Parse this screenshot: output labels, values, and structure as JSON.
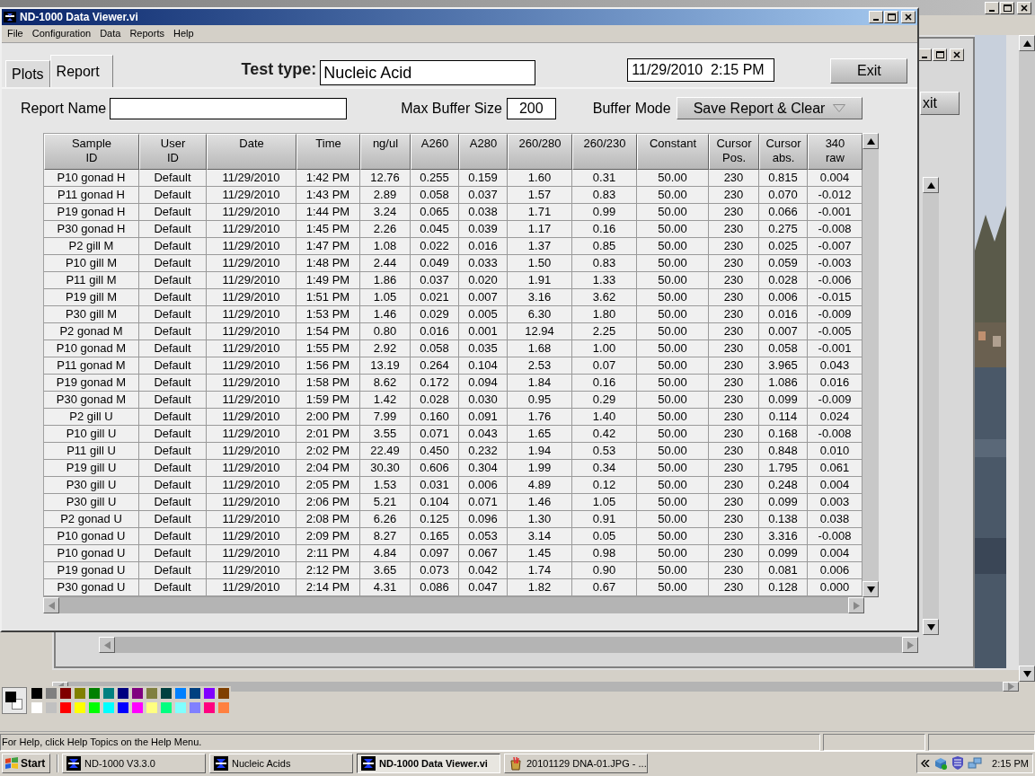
{
  "window": {
    "title": "ND-1000 Data Viewer.vi",
    "menu": [
      "File",
      "Configuration",
      "Data",
      "Reports",
      "Help"
    ]
  },
  "tabs": [
    {
      "label": "Plots",
      "selected": false
    },
    {
      "label": "Report",
      "selected": true
    }
  ],
  "test_type": {
    "label": "Test type:",
    "value": "Nucleic Acid"
  },
  "timestamp": "11/29/2010  2:15 PM",
  "exit_button": "Exit",
  "report_name": {
    "label": "Report Name"
  },
  "max_buffer": {
    "label": "Max Buffer Size",
    "value": "200"
  },
  "buffer_mode": {
    "label": "Buffer Mode",
    "value": "Save Report & Clear"
  },
  "table": {
    "columns": [
      "Sample ID",
      "User ID",
      "Date",
      "Time",
      "ng/ul",
      "A260",
      "A280",
      "260/280",
      "260/230",
      "Constant",
      "Cursor Pos.",
      "Cursor abs.",
      "340 raw"
    ],
    "rows": [
      [
        "P10 gonad H",
        "Default",
        "11/29/2010",
        "1:42 PM",
        "12.76",
        "0.255",
        "0.159",
        "1.60",
        "0.31",
        "50.00",
        "230",
        "0.815",
        "0.004"
      ],
      [
        "P11 gonad H",
        "Default",
        "11/29/2010",
        "1:43 PM",
        "2.89",
        "0.058",
        "0.037",
        "1.57",
        "0.83",
        "50.00",
        "230",
        "0.070",
        "-0.012"
      ],
      [
        "P19 gonad H",
        "Default",
        "11/29/2010",
        "1:44 PM",
        "3.24",
        "0.065",
        "0.038",
        "1.71",
        "0.99",
        "50.00",
        "230",
        "0.066",
        "-0.001"
      ],
      [
        "P30 gonad H",
        "Default",
        "11/29/2010",
        "1:45 PM",
        "2.26",
        "0.045",
        "0.039",
        "1.17",
        "0.16",
        "50.00",
        "230",
        "0.275",
        "-0.008"
      ],
      [
        "P2 gill M",
        "Default",
        "11/29/2010",
        "1:47 PM",
        "1.08",
        "0.022",
        "0.016",
        "1.37",
        "0.85",
        "50.00",
        "230",
        "0.025",
        "-0.007"
      ],
      [
        "P10 gill M",
        "Default",
        "11/29/2010",
        "1:48 PM",
        "2.44",
        "0.049",
        "0.033",
        "1.50",
        "0.83",
        "50.00",
        "230",
        "0.059",
        "-0.003"
      ],
      [
        "P11 gill M",
        "Default",
        "11/29/2010",
        "1:49 PM",
        "1.86",
        "0.037",
        "0.020",
        "1.91",
        "1.33",
        "50.00",
        "230",
        "0.028",
        "-0.006"
      ],
      [
        "P19 gill M",
        "Default",
        "11/29/2010",
        "1:51 PM",
        "1.05",
        "0.021",
        "0.007",
        "3.16",
        "3.62",
        "50.00",
        "230",
        "0.006",
        "-0.015"
      ],
      [
        "P30 gill M",
        "Default",
        "11/29/2010",
        "1:53 PM",
        "1.46",
        "0.029",
        "0.005",
        "6.30",
        "1.80",
        "50.00",
        "230",
        "0.016",
        "-0.009"
      ],
      [
        "P2 gonad M",
        "Default",
        "11/29/2010",
        "1:54 PM",
        "0.80",
        "0.016",
        "0.001",
        "12.94",
        "2.25",
        "50.00",
        "230",
        "0.007",
        "-0.005"
      ],
      [
        "P10 gonad M",
        "Default",
        "11/29/2010",
        "1:55 PM",
        "2.92",
        "0.058",
        "0.035",
        "1.68",
        "1.00",
        "50.00",
        "230",
        "0.058",
        "-0.001"
      ],
      [
        "P11 gonad M",
        "Default",
        "11/29/2010",
        "1:56 PM",
        "13.19",
        "0.264",
        "0.104",
        "2.53",
        "0.07",
        "50.00",
        "230",
        "3.965",
        "0.043"
      ],
      [
        "P19 gonad M",
        "Default",
        "11/29/2010",
        "1:58 PM",
        "8.62",
        "0.172",
        "0.094",
        "1.84",
        "0.16",
        "50.00",
        "230",
        "1.086",
        "0.016"
      ],
      [
        "P30 gonad M",
        "Default",
        "11/29/2010",
        "1:59 PM",
        "1.42",
        "0.028",
        "0.030",
        "0.95",
        "0.29",
        "50.00",
        "230",
        "0.099",
        "-0.009"
      ],
      [
        "P2 gill U",
        "Default",
        "11/29/2010",
        "2:00 PM",
        "7.99",
        "0.160",
        "0.091",
        "1.76",
        "1.40",
        "50.00",
        "230",
        "0.114",
        "0.024"
      ],
      [
        "P10 gill U",
        "Default",
        "11/29/2010",
        "2:01 PM",
        "3.55",
        "0.071",
        "0.043",
        "1.65",
        "0.42",
        "50.00",
        "230",
        "0.168",
        "-0.008"
      ],
      [
        "P11 gill U",
        "Default",
        "11/29/2010",
        "2:02 PM",
        "22.49",
        "0.450",
        "0.232",
        "1.94",
        "0.53",
        "50.00",
        "230",
        "0.848",
        "0.010"
      ],
      [
        "P19 gill U",
        "Default",
        "11/29/2010",
        "2:04 PM",
        "30.30",
        "0.606",
        "0.304",
        "1.99",
        "0.34",
        "50.00",
        "230",
        "1.795",
        "0.061"
      ],
      [
        "P30 gill U",
        "Default",
        "11/29/2010",
        "2:05 PM",
        "1.53",
        "0.031",
        "0.006",
        "4.89",
        "0.12",
        "50.00",
        "230",
        "0.248",
        "0.004"
      ],
      [
        "P30 gill U",
        "Default",
        "11/29/2010",
        "2:06 PM",
        "5.21",
        "0.104",
        "0.071",
        "1.46",
        "1.05",
        "50.00",
        "230",
        "0.099",
        "0.003"
      ],
      [
        "P2 gonad U",
        "Default",
        "11/29/2010",
        "2:08 PM",
        "6.26",
        "0.125",
        "0.096",
        "1.30",
        "0.91",
        "50.00",
        "230",
        "0.138",
        "0.038"
      ],
      [
        "P10 gonad U",
        "Default",
        "11/29/2010",
        "2:09 PM",
        "8.27",
        "0.165",
        "0.053",
        "3.14",
        "0.05",
        "50.00",
        "230",
        "3.316",
        "-0.008"
      ],
      [
        "P10 gonad U",
        "Default",
        "11/29/2010",
        "2:11 PM",
        "4.84",
        "0.097",
        "0.067",
        "1.45",
        "0.98",
        "50.00",
        "230",
        "0.099",
        "0.004"
      ],
      [
        "P19 gonad U",
        "Default",
        "11/29/2010",
        "2:12 PM",
        "3.65",
        "0.073",
        "0.042",
        "1.74",
        "0.90",
        "50.00",
        "230",
        "0.081",
        "0.006"
      ],
      [
        "P30 gonad U",
        "Default",
        "11/29/2010",
        "2:14 PM",
        "4.31",
        "0.086",
        "0.047",
        "1.82",
        "0.67",
        "50.00",
        "230",
        "0.128",
        "0.000"
      ]
    ]
  },
  "background_window": {
    "button": "xit"
  },
  "palette": [
    {
      "color": "#000000"
    },
    {
      "color": "#808080"
    },
    {
      "color": "#800000"
    },
    {
      "color": "#808000"
    },
    {
      "color": "#008000"
    },
    {
      "color": "#008080"
    },
    {
      "color": "#000080"
    },
    {
      "color": "#800080"
    },
    {
      "color": "#808040"
    },
    {
      "color": "#004040"
    },
    {
      "color": "#0080ff"
    },
    {
      "color": "#004080"
    },
    {
      "color": "#8000ff"
    },
    {
      "color": "#804000"
    },
    {
      "color": "#ffffff"
    },
    {
      "color": "#c0c0c0"
    },
    {
      "color": "#ff0000"
    },
    {
      "color": "#ffff00"
    },
    {
      "color": "#00ff00"
    },
    {
      "color": "#00ffff"
    },
    {
      "color": "#0000ff"
    },
    {
      "color": "#ff00ff"
    },
    {
      "color": "#ffff80"
    },
    {
      "color": "#00ff80"
    },
    {
      "color": "#80ffff"
    },
    {
      "color": "#8080ff"
    },
    {
      "color": "#ff0080"
    },
    {
      "color": "#ff8040"
    }
  ],
  "status_bar": "For Help, click Help Topics on the Help Menu.",
  "taskbar": {
    "start": "Start",
    "items": [
      {
        "label": "ND-1000 V3.3.0",
        "kind": "nd",
        "selected": false
      },
      {
        "label": "Nucleic Acids",
        "kind": "nd",
        "selected": false
      },
      {
        "label": "ND-1000 Data Viewer.vi",
        "kind": "nd",
        "selected": true
      },
      {
        "label": "20101129 DNA-01.JPG - ...",
        "kind": "paint",
        "selected": false
      }
    ],
    "clock": "2:15 PM"
  }
}
